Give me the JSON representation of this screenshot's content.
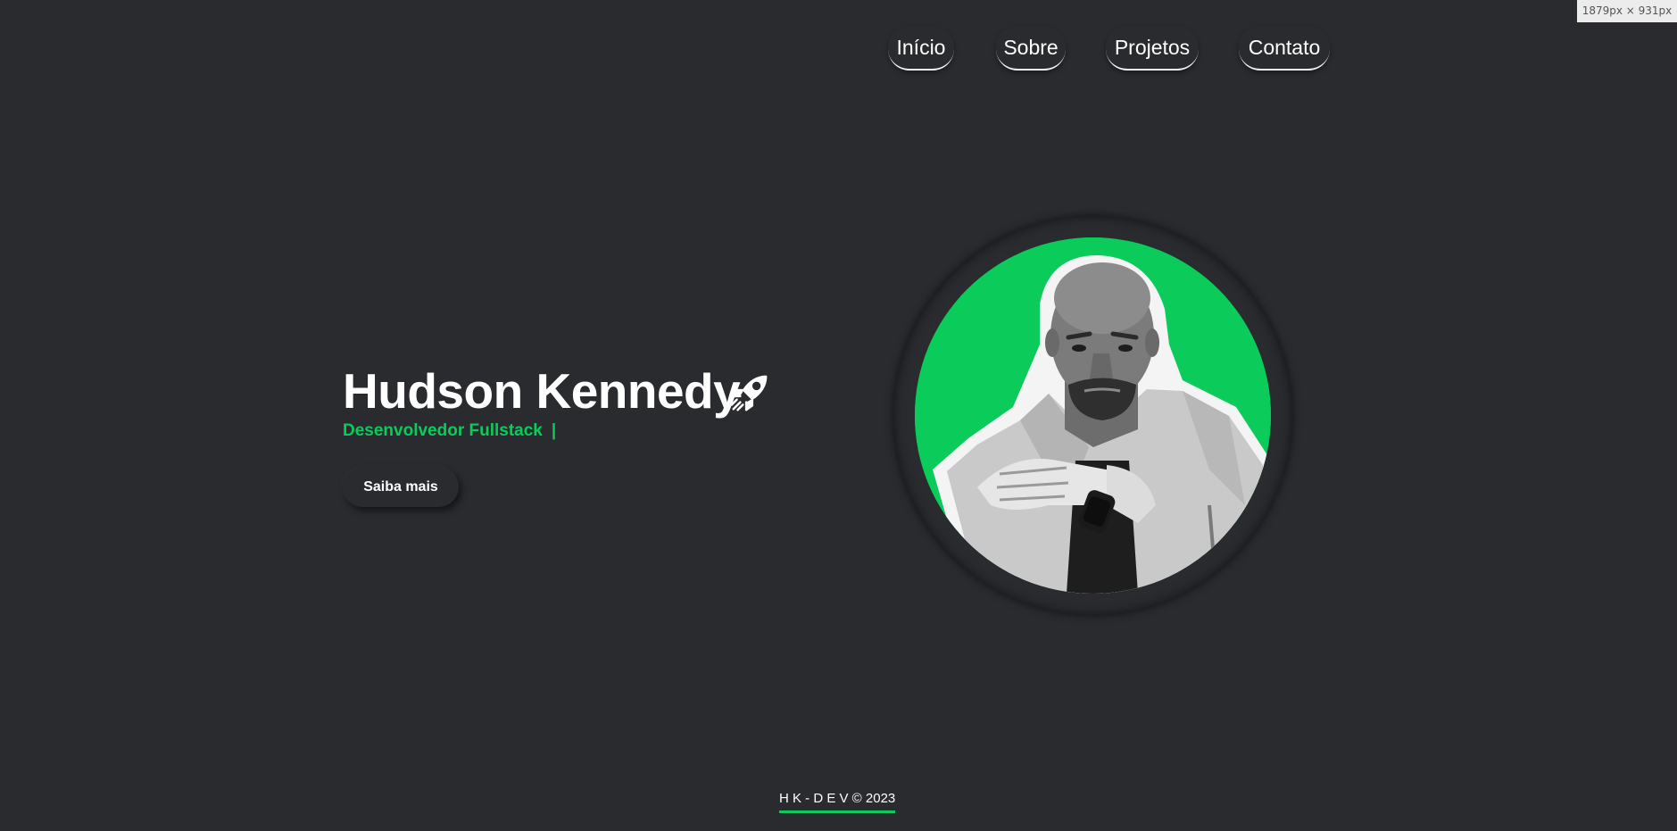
{
  "viewport_badge": "1879px × 931px",
  "nav": {
    "items": [
      {
        "label": "Início"
      },
      {
        "label": "Sobre"
      },
      {
        "label": "Projetos"
      },
      {
        "label": "Contato"
      }
    ]
  },
  "hero": {
    "name": "Hudson Kennedy",
    "name_icon": "rocket-icon",
    "subtitle": "Desenvolvedor Fullstack",
    "cursor": "|",
    "button_label": "Saiba mais"
  },
  "portrait": {
    "image": "profile-photo",
    "background_color": "#0bcb5a"
  },
  "footer": {
    "text": "H K - D E V © 2023"
  },
  "colors": {
    "background": "#2a2b2f",
    "accent": "#0bcb5a",
    "text": "#ffffff"
  }
}
